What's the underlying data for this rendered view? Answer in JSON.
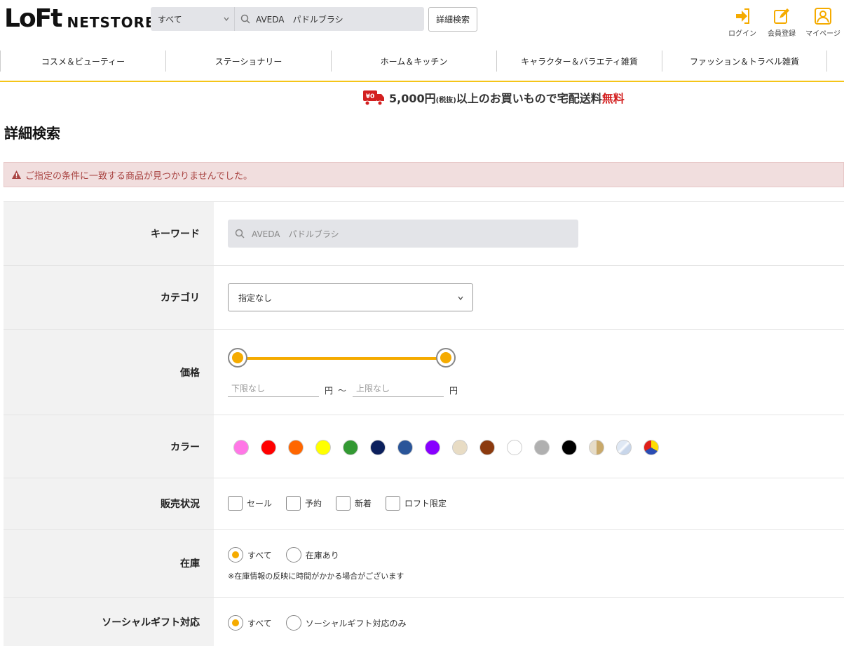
{
  "header": {
    "logo_main": "LoFt",
    "logo_sub": "NETSTORE",
    "search": {
      "scope": "すべて",
      "query": "AVEDA　パドルブラシ"
    },
    "advanced_search_label": "詳細検索",
    "links": {
      "login": "ログイン",
      "register": "会員登録",
      "mypage": "マイページ"
    },
    "accent_color": "#f5ab00"
  },
  "nav": {
    "items": [
      "コスメ＆ビューティー",
      "ステーショナリー",
      "ホーム＆キッチン",
      "キャラクター＆バラエティ雑貨",
      "ファッション＆トラベル雑貨"
    ]
  },
  "promo": {
    "badge": "¥0",
    "amount": "5,000円",
    "tax": "(税抜)",
    "text": "以上のお買いもので宅配送料",
    "free": "無料"
  },
  "page_title": "詳細検索",
  "alert": "ご指定の条件に一致する商品が見つかりませんでした。",
  "form": {
    "keyword": {
      "label": "キーワード",
      "value": "AVEDA　パドルブラシ"
    },
    "category": {
      "label": "カテゴリ",
      "value": "指定なし"
    },
    "price": {
      "label": "価格",
      "min_placeholder": "下限なし",
      "max_placeholder": "上限なし",
      "unit": "円",
      "separator": "〜",
      "slider_min_fraction": 0,
      "slider_max_fraction": 1
    },
    "color": {
      "label": "カラー",
      "swatches": [
        "#ff77e6",
        "#ff0000",
        "#ff6600",
        "#ffff00",
        "#339933",
        "#0b1f5c",
        "#2a5599",
        "#8800ff",
        "#e8dcc4",
        "#8b3a0e",
        "#ffffff",
        "#b0b0b0",
        "#000000",
        "gold",
        "silver",
        "multi"
      ]
    },
    "status": {
      "label": "販売状況",
      "options": [
        "セール",
        "予約",
        "新着",
        "ロフト限定"
      ]
    },
    "stock": {
      "label": "在庫",
      "options": [
        "すべて",
        "在庫あり"
      ],
      "selected": "すべて",
      "note": "※在庫情報の反映に時間がかかる場合がございます"
    },
    "social_gift": {
      "label": "ソーシャルギフト対応",
      "options": [
        "すべて",
        "ソーシャルギフト対応のみ"
      ],
      "selected": "すべて"
    }
  }
}
